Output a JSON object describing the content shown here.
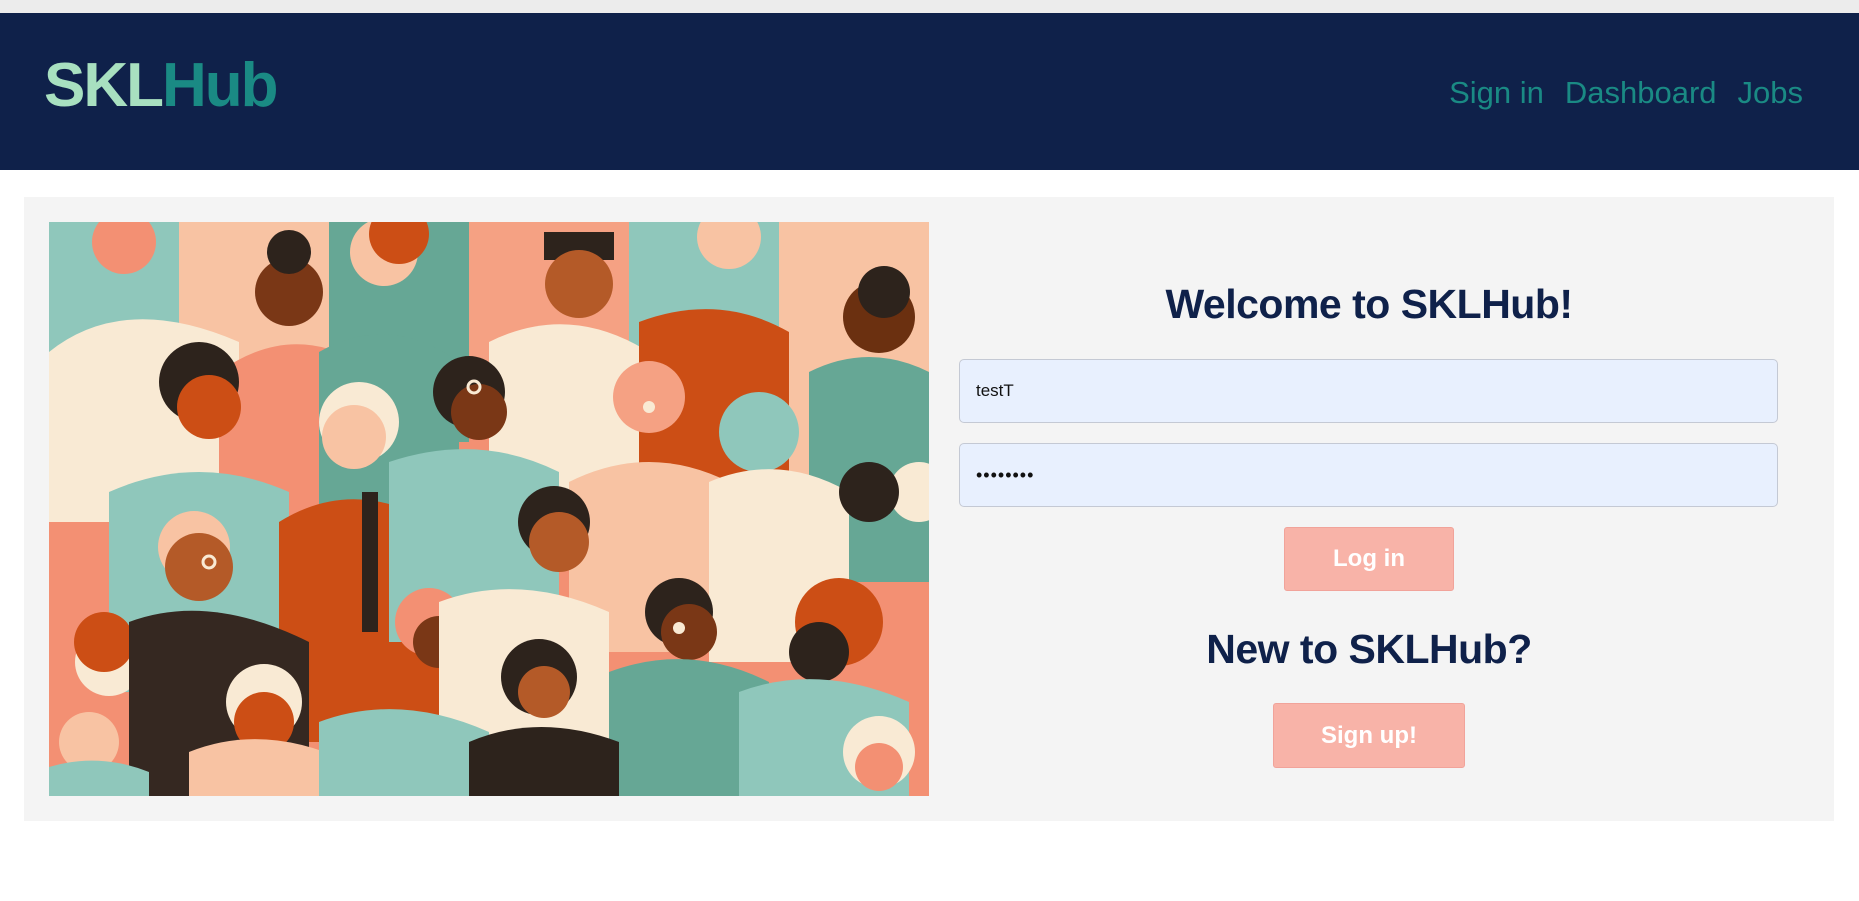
{
  "header": {
    "logo_part1": "SKL",
    "logo_part2": "Hub",
    "nav": [
      {
        "label": "Sign in"
      },
      {
        "label": "Dashboard"
      },
      {
        "label": "Jobs"
      }
    ]
  },
  "login": {
    "welcome_title": "Welcome to SKLHub!",
    "username_value": "testT",
    "password_value": "••••••••",
    "login_label": "Log in"
  },
  "signup": {
    "title": "New to SKLHub?",
    "signup_label": "Sign up!"
  },
  "colors": {
    "navbar": "#0f214a",
    "accent_teal": "#1a8a84",
    "logo_light": "#a8e0c0",
    "button": "#f8b3a8",
    "input_bg": "#e8f0fe"
  },
  "icons": {
    "hero_image": "diverse-crowd-illustration"
  }
}
